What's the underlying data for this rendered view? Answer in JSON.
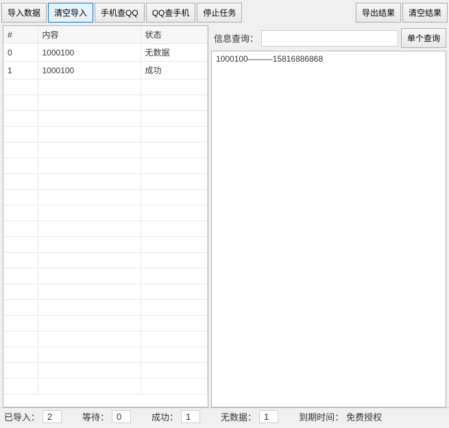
{
  "toolbar": {
    "import_data": "导入数据",
    "clear_import": "清空导入",
    "phone_lookup_qq": "手机查QQ",
    "qq_lookup_phone": "QQ查手机",
    "stop_task": "停止任务",
    "export_result": "导出结果",
    "clear_result": "清空结果"
  },
  "table": {
    "headers": {
      "index": "#",
      "content": "内容",
      "status": "状态"
    },
    "rows": [
      {
        "index": "0",
        "content": "1000100",
        "status": "无数据"
      },
      {
        "index": "1",
        "content": "1000100",
        "status": "成功"
      }
    ]
  },
  "query": {
    "label": "信息查询：",
    "value": "",
    "placeholder": "",
    "single_query_btn": "单个查询"
  },
  "result": {
    "text": "1000100———15816886868"
  },
  "statusbar": {
    "imported_label": "已导入：",
    "imported_value": "2",
    "waiting_label": "等待：",
    "waiting_value": "0",
    "success_label": "成功：",
    "success_value": "1",
    "nodata_label": "无数据：",
    "nodata_value": "1",
    "expire_label": "到期时间：",
    "expire_value": "免费授权"
  }
}
